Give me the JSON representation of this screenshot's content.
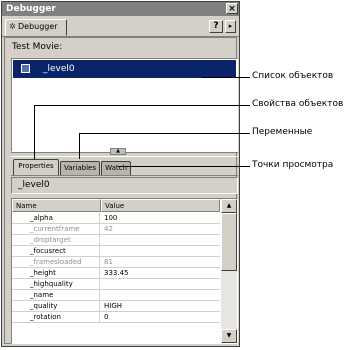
{
  "window": {
    "title": "Debugger",
    "close_label": "×"
  },
  "panel_tab": {
    "label": "Debugger"
  },
  "toolbar": {
    "help_label": "?",
    "menu_label": "▸"
  },
  "movie": {
    "label": "Test Movie:",
    "items": [
      {
        "label": "_level0"
      }
    ]
  },
  "splitter": {
    "handle_label": "▲"
  },
  "tabs": [
    {
      "label": "Properties"
    },
    {
      "label": "Variables"
    },
    {
      "label": "Watch"
    }
  ],
  "object_path": "_level0",
  "grid": {
    "columns": [
      "Name",
      "Value"
    ],
    "rows": [
      {
        "name": "_alpha",
        "value": "100",
        "readonly": false
      },
      {
        "name": "_currentframe",
        "value": "42",
        "readonly": true
      },
      {
        "name": "_droptarget",
        "value": "",
        "readonly": true
      },
      {
        "name": "_focusrect",
        "value": "",
        "readonly": false
      },
      {
        "name": "_framesloaded",
        "value": "81",
        "readonly": true
      },
      {
        "name": "_height",
        "value": "333.45",
        "readonly": false
      },
      {
        "name": "_highquality",
        "value": "",
        "readonly": false
      },
      {
        "name": "_name",
        "value": "",
        "readonly": false
      },
      {
        "name": "_quality",
        "value": "HIGH",
        "readonly": false
      },
      {
        "name": "_rotation",
        "value": "0",
        "readonly": false
      }
    ]
  },
  "scrollbar": {
    "up_label": "▲",
    "down_label": "▼"
  },
  "annotations": {
    "object_list": "Список объектов",
    "object_properties": "Свойства объектов",
    "variables": "Переменные",
    "watch_points": "Точки просмотра"
  }
}
